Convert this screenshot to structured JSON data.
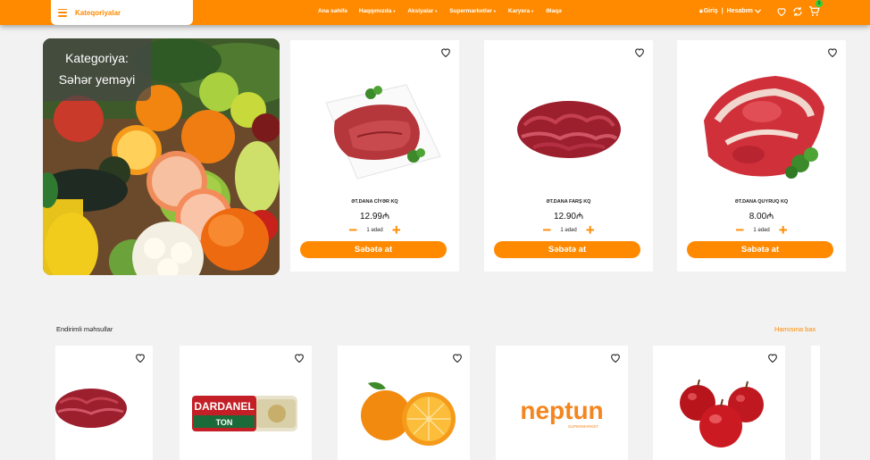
{
  "header": {
    "category_label": "Kateqoriyalar",
    "nav_links": [
      {
        "label": "Ana səhifə",
        "has_caret": false
      },
      {
        "label": "Haqqımızda",
        "has_caret": true
      },
      {
        "label": "Aksiyalar",
        "has_caret": true
      },
      {
        "label": "Supermarketlər",
        "has_caret": true
      },
      {
        "label": "Karyera",
        "has_caret": true
      },
      {
        "label": "Əlaqə",
        "has_caret": false
      }
    ],
    "login_label": "Giriş",
    "separator": "|",
    "account_label": "Hesabım",
    "cart_count": "0",
    "brand_color": "#ff8a00"
  },
  "hero": {
    "line1": "Kategoriya:",
    "line2": "Səhər yeməyi"
  },
  "products": [
    {
      "name": "ƏT.DANA CİYƏR KQ",
      "price": "12.99₼",
      "qty_label": "1 ədəd",
      "button": "Səbətə at"
    },
    {
      "name": "ƏT.DANA FARŞ KQ",
      "price": "12.90₼",
      "qty_label": "1 ədəd",
      "button": "Səbətə at"
    },
    {
      "name": "ƏT.DANA QUYRUQ KQ",
      "price": "8.00₼",
      "qty_label": "1 ədəd",
      "button": "Səbətə at"
    }
  ],
  "discount_section": {
    "title": "Endirimli məhsullar",
    "see_all": "Hamısına bax",
    "items": [
      {
        "icon": "minced-meat-image"
      },
      {
        "icon": "dardanel-tuna-image",
        "brand_text": "DARDANEL",
        "sub_text": "TON"
      },
      {
        "icon": "orange-image"
      },
      {
        "icon": "neptun-logo",
        "brand_text": "neptun",
        "sub_text": "SUPERMARKET"
      },
      {
        "icon": "apples-image"
      }
    ]
  }
}
